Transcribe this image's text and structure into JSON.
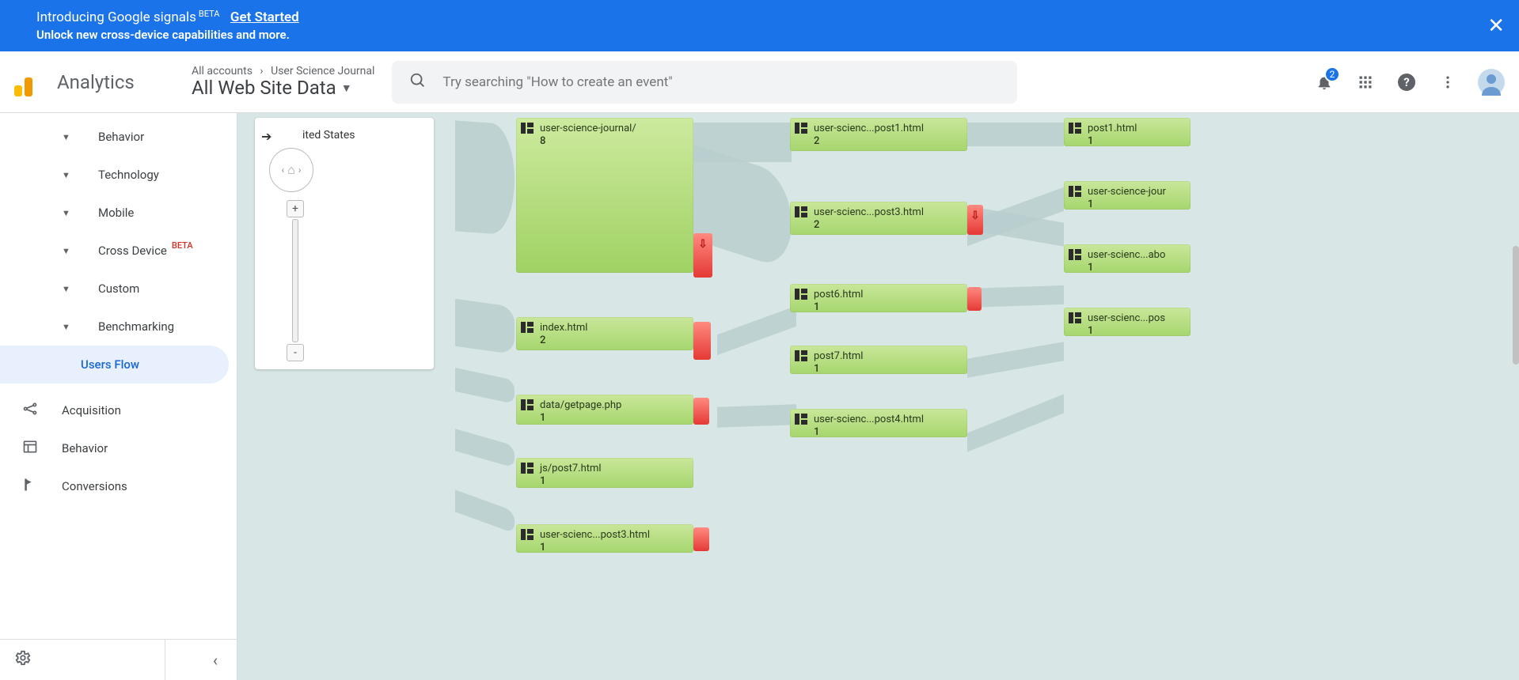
{
  "banner": {
    "intro": "Introducing Google signals",
    "beta": "BETA",
    "sub": "Unlock new cross-device capabilities and more.",
    "cta": "Get Started",
    "close_label": "✕"
  },
  "header": {
    "product": "Analytics",
    "breadcrumb_root": "All accounts",
    "breadcrumb_account": "User Science Journal",
    "view_name": "All Web Site Data",
    "search_placeholder": "Try searching \"How to create an event\"",
    "notification_count": "2"
  },
  "sidebar": {
    "items": [
      {
        "label": "Behavior",
        "chevron": true
      },
      {
        "label": "Technology",
        "chevron": true
      },
      {
        "label": "Mobile",
        "chevron": true
      },
      {
        "label": "Cross Device",
        "chevron": true,
        "beta": "BETA"
      },
      {
        "label": "Custom",
        "chevron": true
      },
      {
        "label": "Benchmarking",
        "chevron": true
      },
      {
        "label": "Users Flow",
        "active": true
      }
    ],
    "sections": [
      {
        "label": "Acquisition"
      },
      {
        "label": "Behavior"
      },
      {
        "label": "Conversions"
      }
    ]
  },
  "mininav": {
    "title": "ited States",
    "plus": "+",
    "minus": "-"
  },
  "flow_nodes": {
    "col1": [
      {
        "label": "user-science-journal/",
        "count": "8"
      },
      {
        "label": "index.html",
        "count": "2"
      },
      {
        "label": "data/getpage.php",
        "count": "1"
      },
      {
        "label": "js/post7.html",
        "count": "1"
      },
      {
        "label": "user-scienc...post3.html",
        "count": "1"
      }
    ],
    "col2": [
      {
        "label": "user-scienc...post1.html",
        "count": "2"
      },
      {
        "label": "user-scienc...post3.html",
        "count": "2"
      },
      {
        "label": "post6.html",
        "count": "1"
      },
      {
        "label": "post7.html",
        "count": "1"
      },
      {
        "label": "user-scienc...post4.html",
        "count": "1"
      }
    ],
    "col3": [
      {
        "label": "post1.html",
        "count": "1"
      },
      {
        "label": "user-science-jour",
        "count": "1"
      },
      {
        "label": "user-scienc...abo",
        "count": "1"
      },
      {
        "label": "user-scienc...pos",
        "count": "1"
      }
    ]
  },
  "dropoff_glyph": "⇩"
}
